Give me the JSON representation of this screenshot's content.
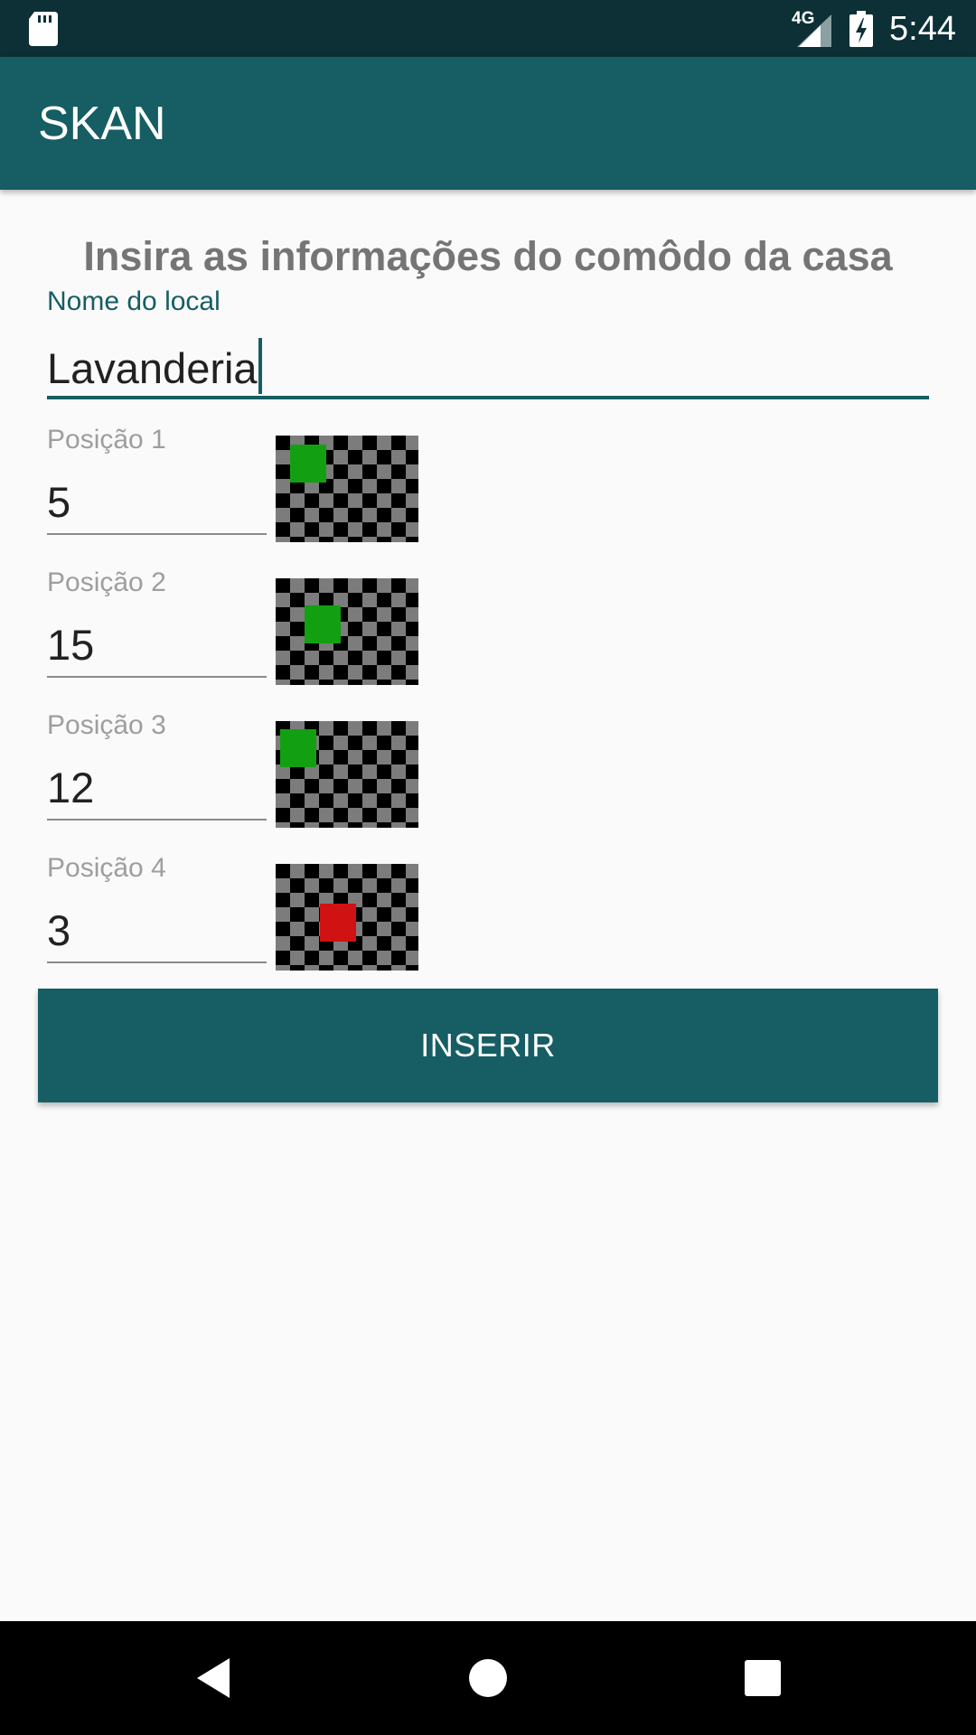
{
  "status_bar": {
    "network_label": "4G",
    "time": "5:44",
    "icons": [
      "sd-card-icon",
      "signal-icon",
      "battery-charging-icon"
    ]
  },
  "app_bar": {
    "title": "SKAN"
  },
  "form": {
    "heading": "Insira as informações do comôdo da casa",
    "location": {
      "label": "Nome do local",
      "value": "Lavanderia"
    },
    "positions": [
      {
        "label": "Posição 1",
        "value": "5",
        "marker_color": "#12a012"
      },
      {
        "label": "Posição 2",
        "value": "15",
        "marker_color": "#12a012"
      },
      {
        "label": "Posição 3",
        "value": "12",
        "marker_color": "#12a012"
      },
      {
        "label": "Posição 4",
        "value": "3",
        "marker_color": "#d01212"
      }
    ],
    "submit_label": "INSERIR"
  },
  "colors": {
    "primary": "#165e63",
    "primary_dark": "#0c3036",
    "marker_green": "#12a012",
    "marker_red": "#d01212"
  },
  "nav_bar": {
    "icons": [
      "back-icon",
      "home-icon",
      "recents-icon"
    ]
  }
}
